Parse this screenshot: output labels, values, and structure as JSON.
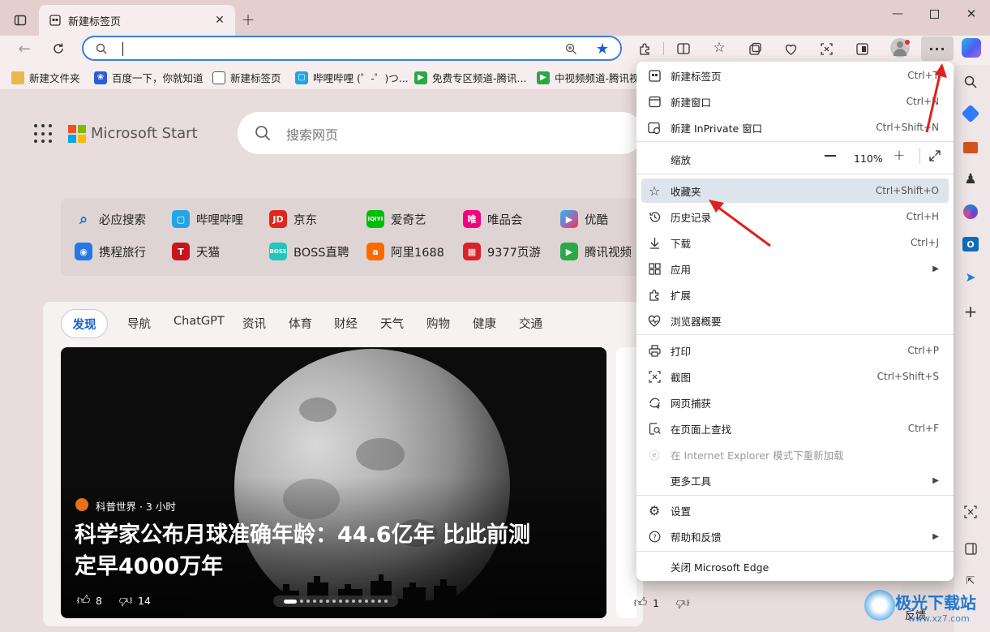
{
  "tab": {
    "title": "新建标签页"
  },
  "addressbar": {
    "value": "",
    "placeholder": ""
  },
  "bookmarks": [
    {
      "label": "新建文件夹",
      "color": "#e8b84a"
    },
    {
      "label": "百度一下，你就知道",
      "color": "#2b5cd6"
    },
    {
      "label": "新建标签页",
      "color": "#555555"
    },
    {
      "label": "哔哩哔哩 (゜-゜)つ...",
      "color": "#23a4e5"
    },
    {
      "label": "免费专区频道-腾讯...",
      "color": "#2aa84a"
    },
    {
      "label": "中视频频道-腾讯视",
      "color": "#2aa84a"
    }
  ],
  "newtab": {
    "brand": "Microsoft Start",
    "search_placeholder": "搜索网页",
    "quick_links": [
      "必应搜索",
      "哔哩哔哩",
      "京东",
      "爱奇艺",
      "唯品会",
      "优酷",
      "携程旅行",
      "天猫",
      "BOSS直聘",
      "阿里1688",
      "9377页游",
      "腾讯视频"
    ],
    "nav_tabs": [
      "发现",
      "导航",
      "ChatGPT",
      "资讯",
      "体育",
      "财经",
      "天气",
      "购物",
      "健康",
      "交通"
    ],
    "hero": {
      "source": "科普世界 · 3 小时",
      "headline_line1": "科学家公布月球准确年龄：44.6亿年 比此前测",
      "headline_line2": "定早4000万年",
      "likes": "8",
      "dislikes": "14"
    },
    "side_card": {
      "likes": "1",
      "feedback": "反馈"
    }
  },
  "menu": {
    "items": [
      {
        "label": "新建标签页",
        "shortcut": "Ctrl+T",
        "icon": "new-tab-icon"
      },
      {
        "label": "新建窗口",
        "shortcut": "Ctrl+N",
        "icon": "new-window-icon"
      },
      {
        "label": "新建 InPrivate 窗口",
        "shortcut": "Ctrl+Shift+N",
        "icon": "inprivate-icon"
      },
      {
        "label": "缩放",
        "zoom": "110%",
        "icon": ""
      },
      {
        "label": "收藏夹",
        "shortcut": "Ctrl+Shift+O",
        "icon": "favorites-icon"
      },
      {
        "label": "历史记录",
        "shortcut": "Ctrl+H",
        "icon": "history-icon"
      },
      {
        "label": "下载",
        "shortcut": "Ctrl+J",
        "icon": "download-icon"
      },
      {
        "label": "应用",
        "shortcut": "",
        "icon": "apps-icon"
      },
      {
        "label": "扩展",
        "shortcut": "",
        "icon": "extensions-icon"
      },
      {
        "label": "浏览器概要",
        "shortcut": "",
        "icon": "browser-essentials-icon"
      },
      {
        "label": "打印",
        "shortcut": "Ctrl+P",
        "icon": "print-icon"
      },
      {
        "label": "截图",
        "shortcut": "Ctrl+Shift+S",
        "icon": "screenshot-icon"
      },
      {
        "label": "网页捕获",
        "shortcut": "",
        "icon": "web-capture-icon"
      },
      {
        "label": "在页面上查找",
        "shortcut": "Ctrl+F",
        "icon": "find-icon"
      },
      {
        "label": "在 Internet Explorer 模式下重新加载",
        "shortcut": "",
        "icon": "ie-mode-icon"
      },
      {
        "label": "更多工具",
        "shortcut": "",
        "icon": ""
      },
      {
        "label": "设置",
        "shortcut": "",
        "icon": "settings-icon"
      },
      {
        "label": "帮助和反馈",
        "shortcut": "",
        "icon": "help-icon"
      },
      {
        "label": "关闭 Microsoft Edge",
        "shortcut": "",
        "icon": ""
      }
    ]
  },
  "watermark": "极光下载站",
  "watermark_url": "www.xz7.com",
  "colors": {
    "accent": "#3a7fd6",
    "highlight": "#dfe6ee",
    "annotation": "#e02020"
  }
}
